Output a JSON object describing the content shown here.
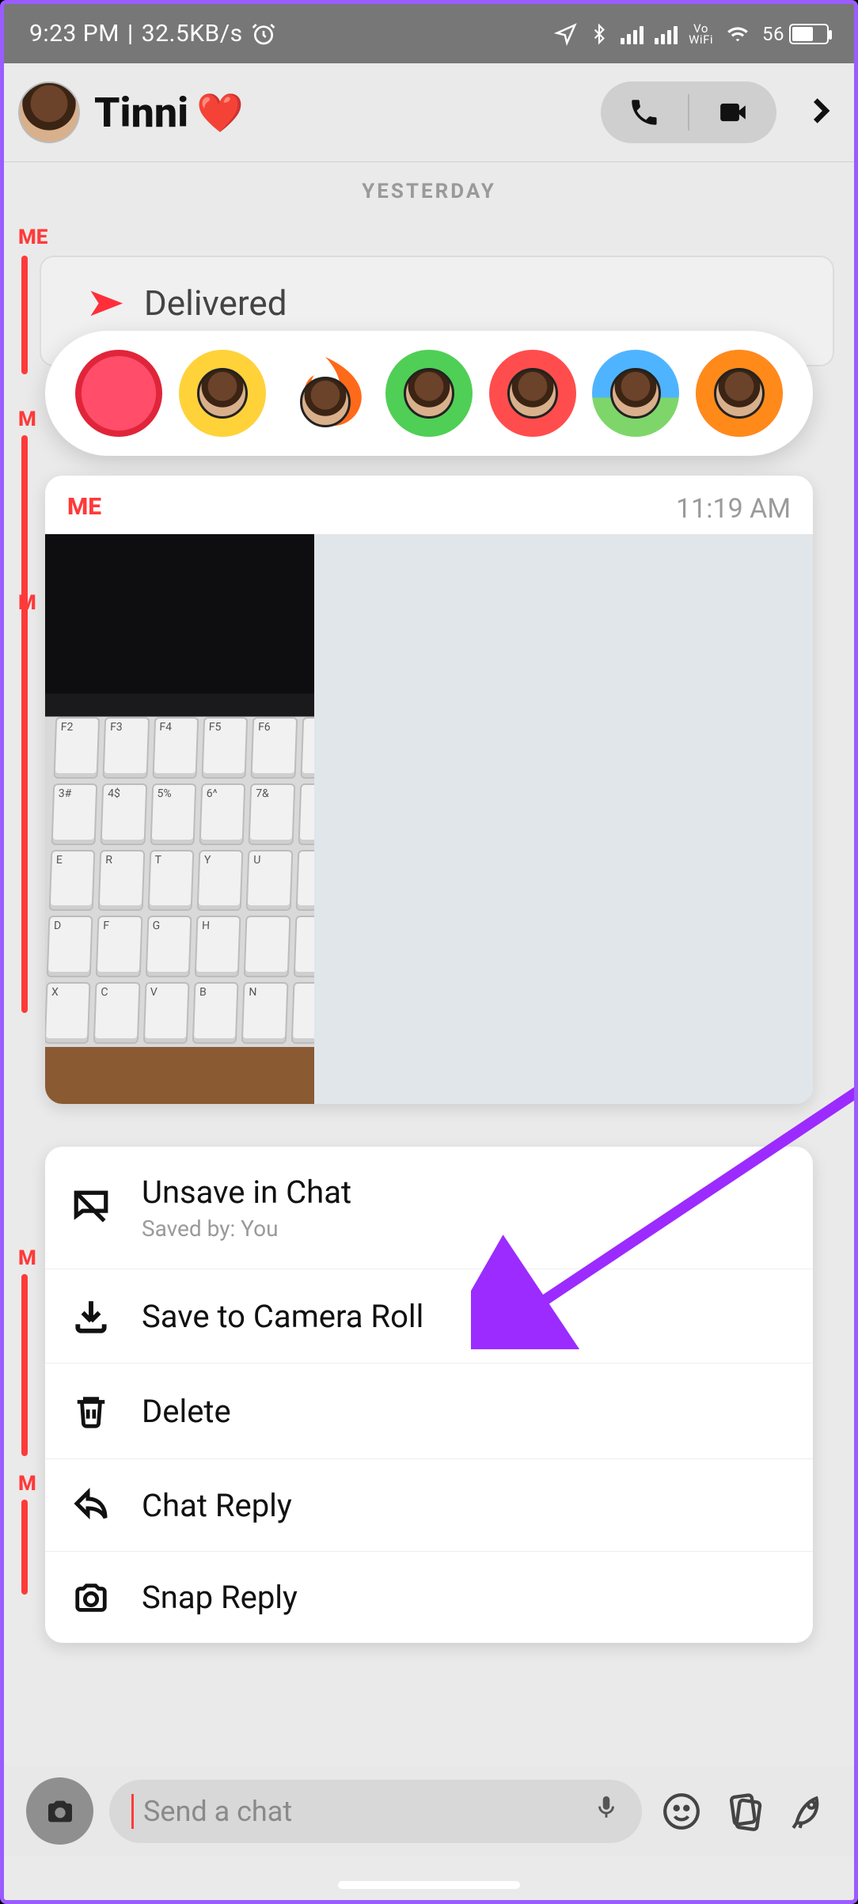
{
  "status": {
    "time": "9:23 PM",
    "net_speed": "32.5KB/s",
    "battery_pct": "56",
    "vowifi_top": "Vo",
    "vowifi_bot": "WiFi"
  },
  "header": {
    "name": "Tinni",
    "heart": "❤️"
  },
  "day_label": "YESTERDAY",
  "me_label": "ME",
  "delivered_label": "Delivered",
  "media": {
    "sender": "ME",
    "time": "11:19 AM"
  },
  "menu": {
    "unsave": {
      "title": "Unsave in Chat",
      "sub": "Saved by: You"
    },
    "save_roll": "Save to Camera Roll",
    "delete": "Delete",
    "chat_reply": "Chat Reply",
    "snap_reply": "Snap Reply"
  },
  "input": {
    "placeholder": "Send a chat"
  },
  "reactions": [
    "heart",
    "laugh-cry",
    "fire",
    "thumbs-up",
    "thumbs-down",
    "shock",
    "mind-blown"
  ]
}
